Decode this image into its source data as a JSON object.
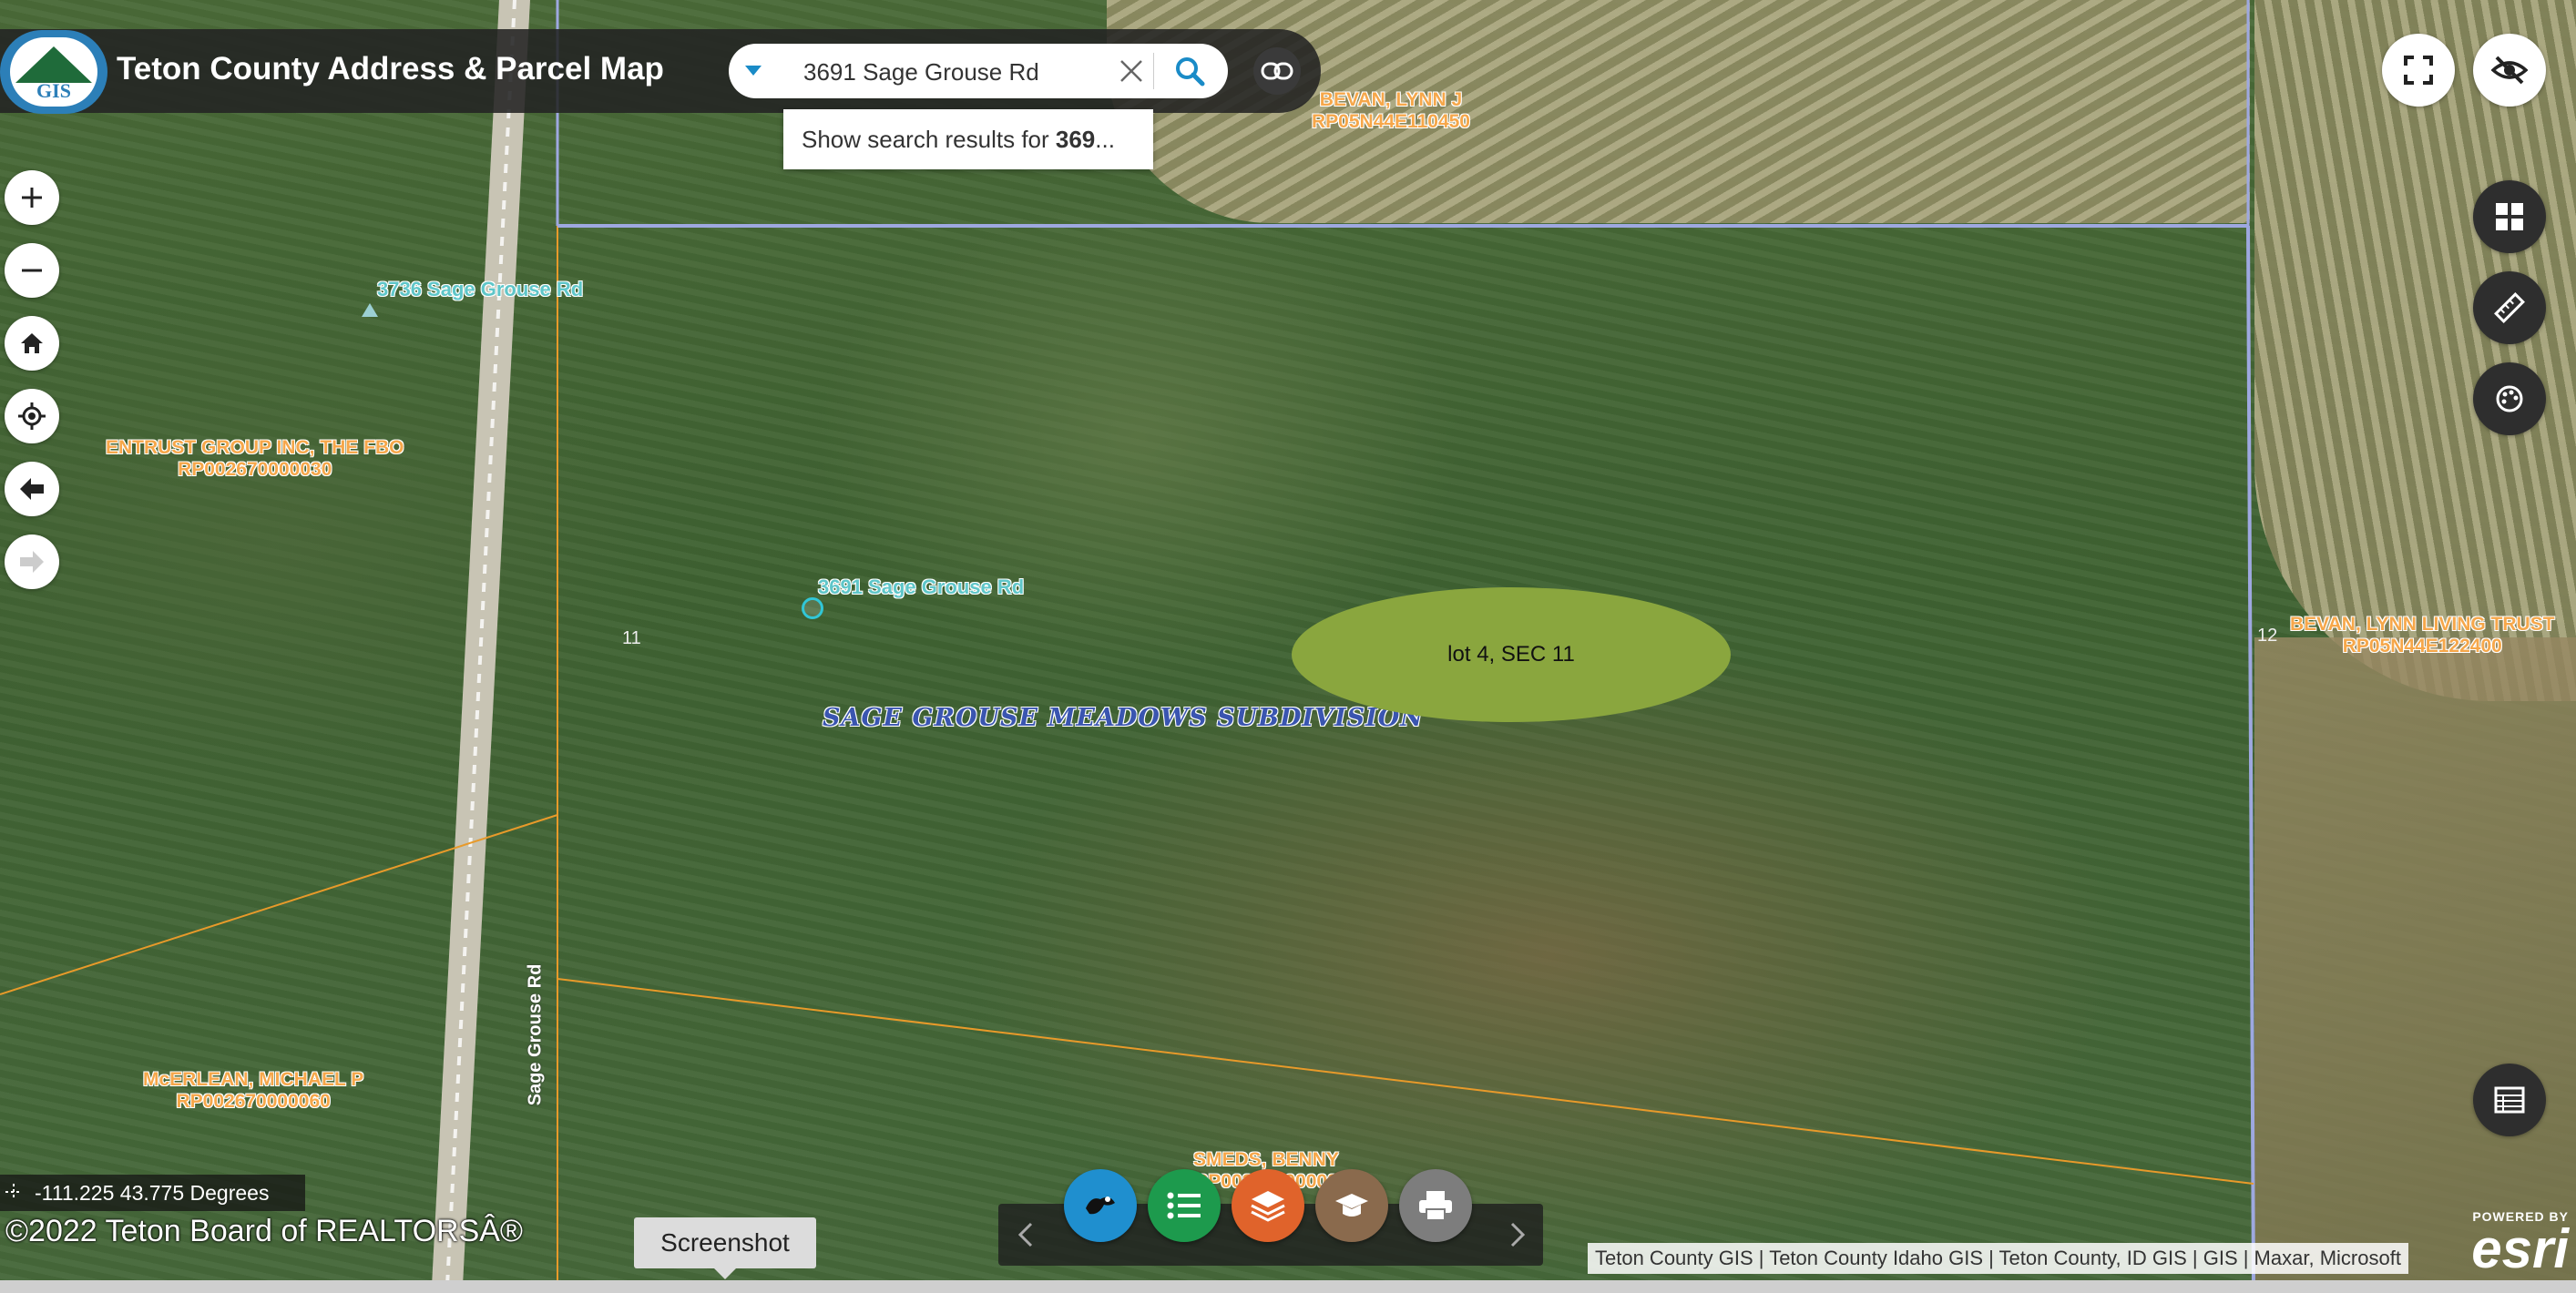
{
  "app": {
    "title": "Teton County Address & Parcel Map",
    "logo_text": "GIS"
  },
  "search": {
    "value": "3691 Sage Grouse Rd",
    "suggestion_prefix": "Show search results for ",
    "suggestion_bold": "369",
    "suggestion_suffix": "..."
  },
  "map": {
    "owner_labels": [
      {
        "name": "BEVAN, LYNN J",
        "parcel": "RP05N44E110450"
      },
      {
        "name": "ENTRUST GROUP INC, THE FBO",
        "parcel": "RP002670000030"
      },
      {
        "name": "BEVAN, LYNN LIVING TRUST",
        "parcel": "RP05N44E122400"
      },
      {
        "name": "McERLEAN, MICHAEL P",
        "parcel": "RP002670000060"
      },
      {
        "name": "SMEDS, BENNY",
        "parcel": "RP00200000000"
      }
    ],
    "address_labels": [
      "3736 Sage Grouse Rd",
      "3691 Sage Grouse Rd"
    ],
    "section_labels": [
      "11",
      "12"
    ],
    "subdivision_label": "SAGE GROUSE MEADOWS SUBDIVISION",
    "road_label": "Sage Grouse Rd",
    "lot_label": "lot 4, SEC 11"
  },
  "status": {
    "coordinates": "-111.225 43.775 Degrees",
    "copyright": "©2022 Teton Board of REALTORSÂ®",
    "tooltip": "Screenshot"
  },
  "attribution": "Teton County GIS | Teton County Idaho GIS | Teton County, ID GIS | GIS | Maxar, Microsoft",
  "esri": {
    "powered_by": "POWERED BY",
    "brand": "esri"
  },
  "colors": {
    "header_bg": "#232323",
    "accent": "#1a8bc7",
    "owner_label": "#f6a74a",
    "address_label": "#5fc6c9",
    "subdivision_label": "#3a55b0",
    "lot_fill": "#8aa63e",
    "parcel_line": "#e89a2a",
    "section_line": "#9ea8e0"
  },
  "toolbar_icons": [
    "basemap-gallery-icon",
    "legend-icon",
    "layers-icon",
    "education-icon",
    "print-icon"
  ]
}
